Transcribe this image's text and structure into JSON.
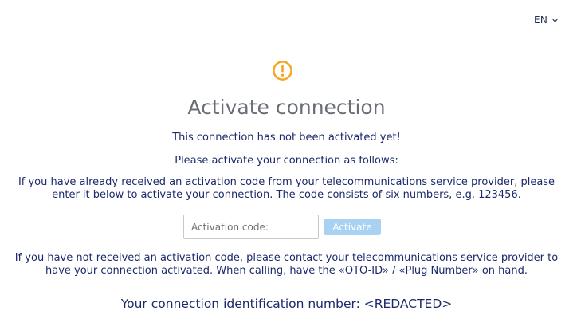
{
  "language": {
    "selected": "EN",
    "chevron_icon": "chevron-down-icon"
  },
  "status_icon": {
    "name": "warning-circle-icon",
    "color": "#f5a623"
  },
  "title": "Activate connection",
  "messages": {
    "not_activated": "This connection has not been activated yet!",
    "instructions": "Please activate your connection as follows:",
    "have_code": "If you have already received an activation code from your telecommunications service provider, please enter it below to activate your connection. The code consists of six numbers, e.g. 123456.",
    "no_code": "If you have not received an activation code, please contact your telecommunications service provider to have your connection activated. When calling, have the «OTO-ID» / «Plug Number» on hand."
  },
  "form": {
    "activation_code": {
      "placeholder": "Activation code:",
      "value": ""
    },
    "activate_label": "Activate"
  },
  "identification": "Your connection identification number: <REDACTED>",
  "colors": {
    "text_primary": "#1c2a6b",
    "title_gray": "#6a6e78",
    "button_disabled": "#a9d2f2",
    "warning": "#f5a623"
  }
}
